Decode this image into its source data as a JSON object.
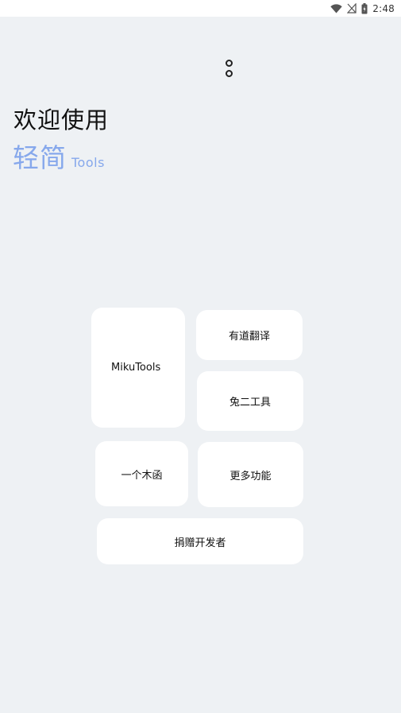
{
  "status_bar": {
    "time": "2:48",
    "icons": [
      "wifi-icon",
      "no-signal-icon",
      "battery-icon"
    ]
  },
  "header": {
    "menu_icon": "more-vert-icon",
    "welcome": "欢迎使用",
    "brand_name": "轻简",
    "brand_sub": "Tools"
  },
  "colors": {
    "background": "#eef1f4",
    "card": "#ffffff",
    "brand_accent": "#86a8ec"
  },
  "cards": {
    "mikutools": "MikuTools",
    "youdao": "有道翻译",
    "tuer": "兔二工具",
    "yigemuhan": "一个木函",
    "more": "更多功能",
    "donate": "捐赠开发者"
  }
}
